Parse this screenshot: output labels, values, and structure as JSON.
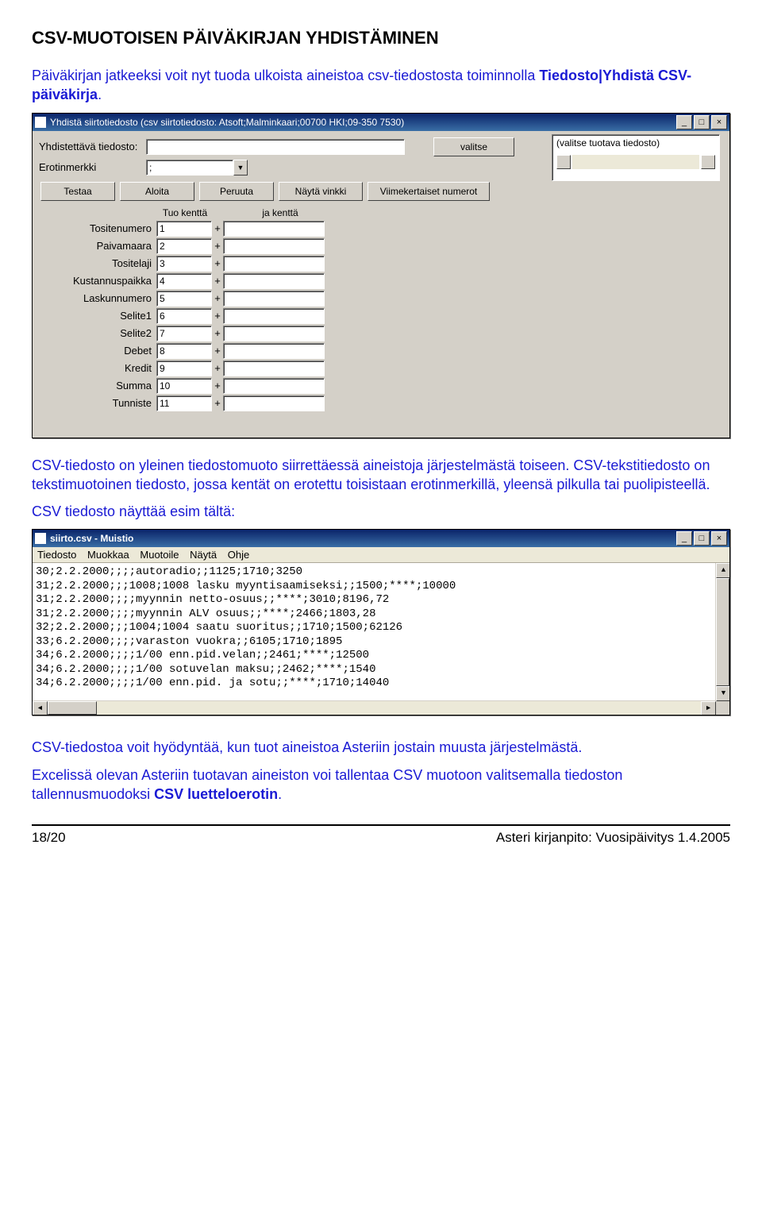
{
  "heading": "CSV-MUOTOISEN PÄIVÄKIRJAN YHDISTÄMINEN",
  "intro_pre": "Päiväkirjan jatkeeksi voit nyt tuoda ulkoista aineistoa csv-tiedostosta toiminnolla ",
  "intro_bold": "Tiedosto|Yhdistä CSV-päiväkirja",
  "intro_post": ".",
  "win1": {
    "title": "Yhdistä siirtotiedosto (csv siirtotiedosto: Atsoft;Malminkaari;00700 HKI;09-350 7530)",
    "labels": {
      "file": "Yhdistettävä tiedosto:",
      "sep": "Erotinmerkki"
    },
    "sep_value": ";",
    "btn_choose": "valitse",
    "right_hint": "(valitse tuotava tiedosto)",
    "buttons": [
      "Testaa",
      "Aloita",
      "Peruuta",
      "Näytä vinkki",
      "Viimekertaiset numerot"
    ],
    "field_head1": "Tuo kenttä",
    "field_head2": "ja kenttä",
    "fields": [
      {
        "label": "Tositenumero",
        "v": "1"
      },
      {
        "label": "Paivamaara",
        "v": "2"
      },
      {
        "label": "Tositelaji",
        "v": "3"
      },
      {
        "label": "Kustannuspaikka",
        "v": "4"
      },
      {
        "label": "Laskunnumero",
        "v": "5"
      },
      {
        "label": "Selite1",
        "v": "6"
      },
      {
        "label": "Selite2",
        "v": "7"
      },
      {
        "label": "Debet",
        "v": "8"
      },
      {
        "label": "Kredit",
        "v": "9"
      },
      {
        "label": "Summa",
        "v": "10"
      },
      {
        "label": "Tunniste",
        "v": "11"
      }
    ]
  },
  "para2_a": "CSV-tiedosto on yleinen tiedostomuoto siirrettäessä aineistoja järjestelmästä toiseen. CSV-tekstitiedosto on tekstimuotoinen tiedosto, jossa kentät on erotettu toisistaan erotinmerkillä, yleensä pilkulla tai puolipisteellä.",
  "para2_b": "CSV tiedosto näyttää esim tältä:",
  "notepad": {
    "title": "siirto.csv - Muistio",
    "menu": [
      "Tiedosto",
      "Muokkaa",
      "Muotoile",
      "Näytä",
      "Ohje"
    ],
    "lines": [
      "30;2.2.2000;;;;autoradio;;1125;1710;3250",
      "31;2.2.2000;;;1008;1008 lasku myyntisaamiseksi;;1500;****;10000",
      "31;2.2.2000;;;;myynnin netto-osuus;;****;3010;8196,72",
      "31;2.2.2000;;;;myynnin ALV osuus;;****;2466;1803,28",
      "32;2.2.2000;;;1004;1004 saatu suoritus;;1710;1500;62126",
      "33;6.2.2000;;;;varaston vuokra;;6105;1710;1895",
      "34;6.2.2000;;;;1/00 enn.pid.velan;;2461;****;12500",
      "34;6.2.2000;;;;1/00 sotuvelan maksu;;2462;****;1540",
      "34;6.2.2000;;;;1/00 enn.pid. ja sotu;;****;1710;14040"
    ]
  },
  "para3": "CSV-tiedostoa voit hyödyntää, kun tuot aineistoa Asteriin jostain muusta järjestelmästä.",
  "para4_pre": "Excelissä olevan Asteriin tuotavan aineiston voi tallentaa CSV muotoon valitsemalla tiedoston tallennusmuodoksi ",
  "para4_bold": "CSV luetteloerotin",
  "para4_post": ".",
  "footer_left": "18/20",
  "footer_right": "Asteri kirjanpito: Vuosipäivitys 1.4.2005"
}
